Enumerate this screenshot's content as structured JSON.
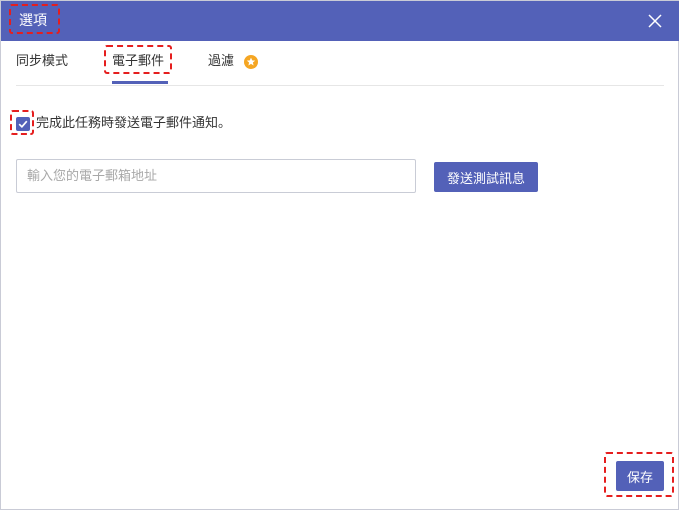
{
  "dialog": {
    "title": "選項",
    "close_icon": "close-icon"
  },
  "tabs": [
    {
      "label": "同步模式",
      "active": false
    },
    {
      "label": "電子郵件",
      "active": true
    },
    {
      "label": "過濾",
      "active": false,
      "badge_icon": "star-icon"
    }
  ],
  "email": {
    "notify_checkbox_label": "完成此任務時發送電子郵件通知。",
    "notify_checked": true,
    "input_placeholder": "輸入您的電子郵箱地址",
    "input_value": "",
    "send_test_label": "發送測試訊息"
  },
  "footer": {
    "save_label": "保存"
  },
  "colors": {
    "accent": "#5361b8",
    "badge": "#f5a623",
    "annotation": "#e51e1e"
  }
}
